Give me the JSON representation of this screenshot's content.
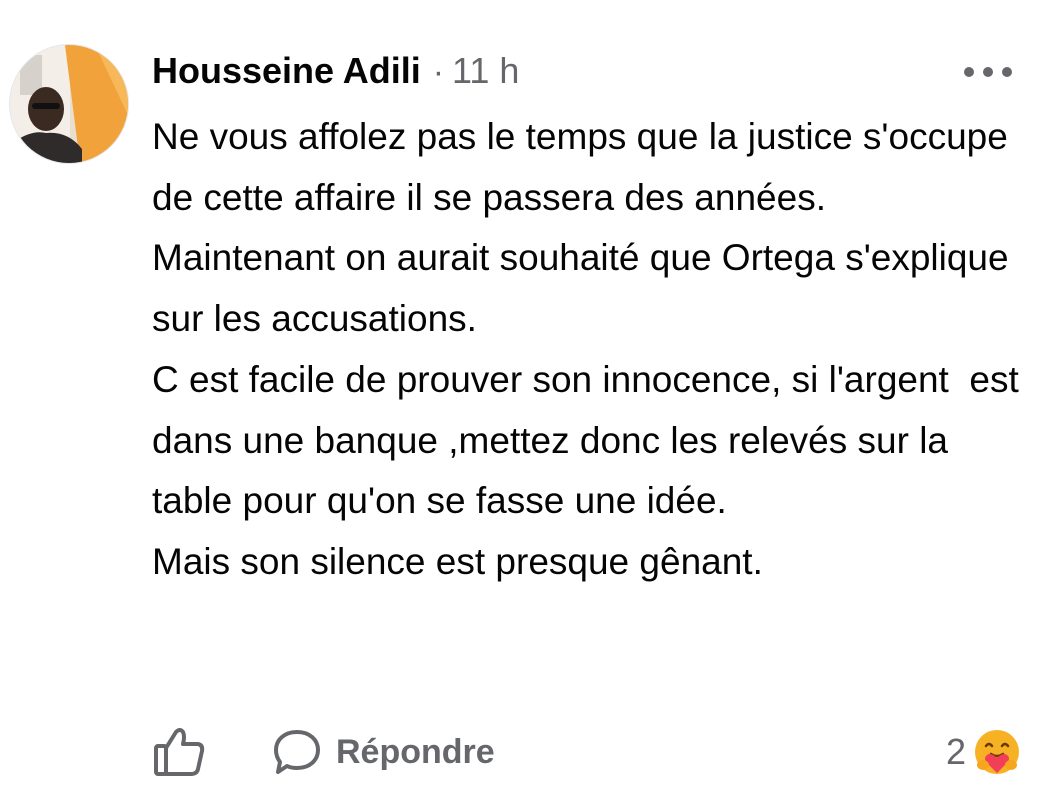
{
  "comment": {
    "author": "Housseine Adili",
    "separator": "·",
    "time": "11 h",
    "paragraphs": [
      "Ne vous affolez pas le temps que la justice s'occupe de cette affaire il se passera des années.",
      "Maintenant on aurait souhaité que Ortega s'explique sur les accusations.",
      "C est facile de prouver son innocence, si l'argent  est dans une banque ,mettez donc les relevés sur la table pour qu'on se fasse une idée.",
      "Mais son silence est presque gênant."
    ]
  },
  "actions": {
    "like_icon": "thumbs-up-icon",
    "reply_icon": "speech-bubble-icon",
    "reply_label": "Répondre",
    "reaction_count": "2",
    "reaction_icon": "care-emoji-icon"
  },
  "menu": {
    "icon": "more-options-icon"
  },
  "colors": {
    "text_primary": "#050505",
    "text_secondary": "#65676b",
    "reaction_face": "#f7b125",
    "reaction_heart": "#f33e58"
  }
}
